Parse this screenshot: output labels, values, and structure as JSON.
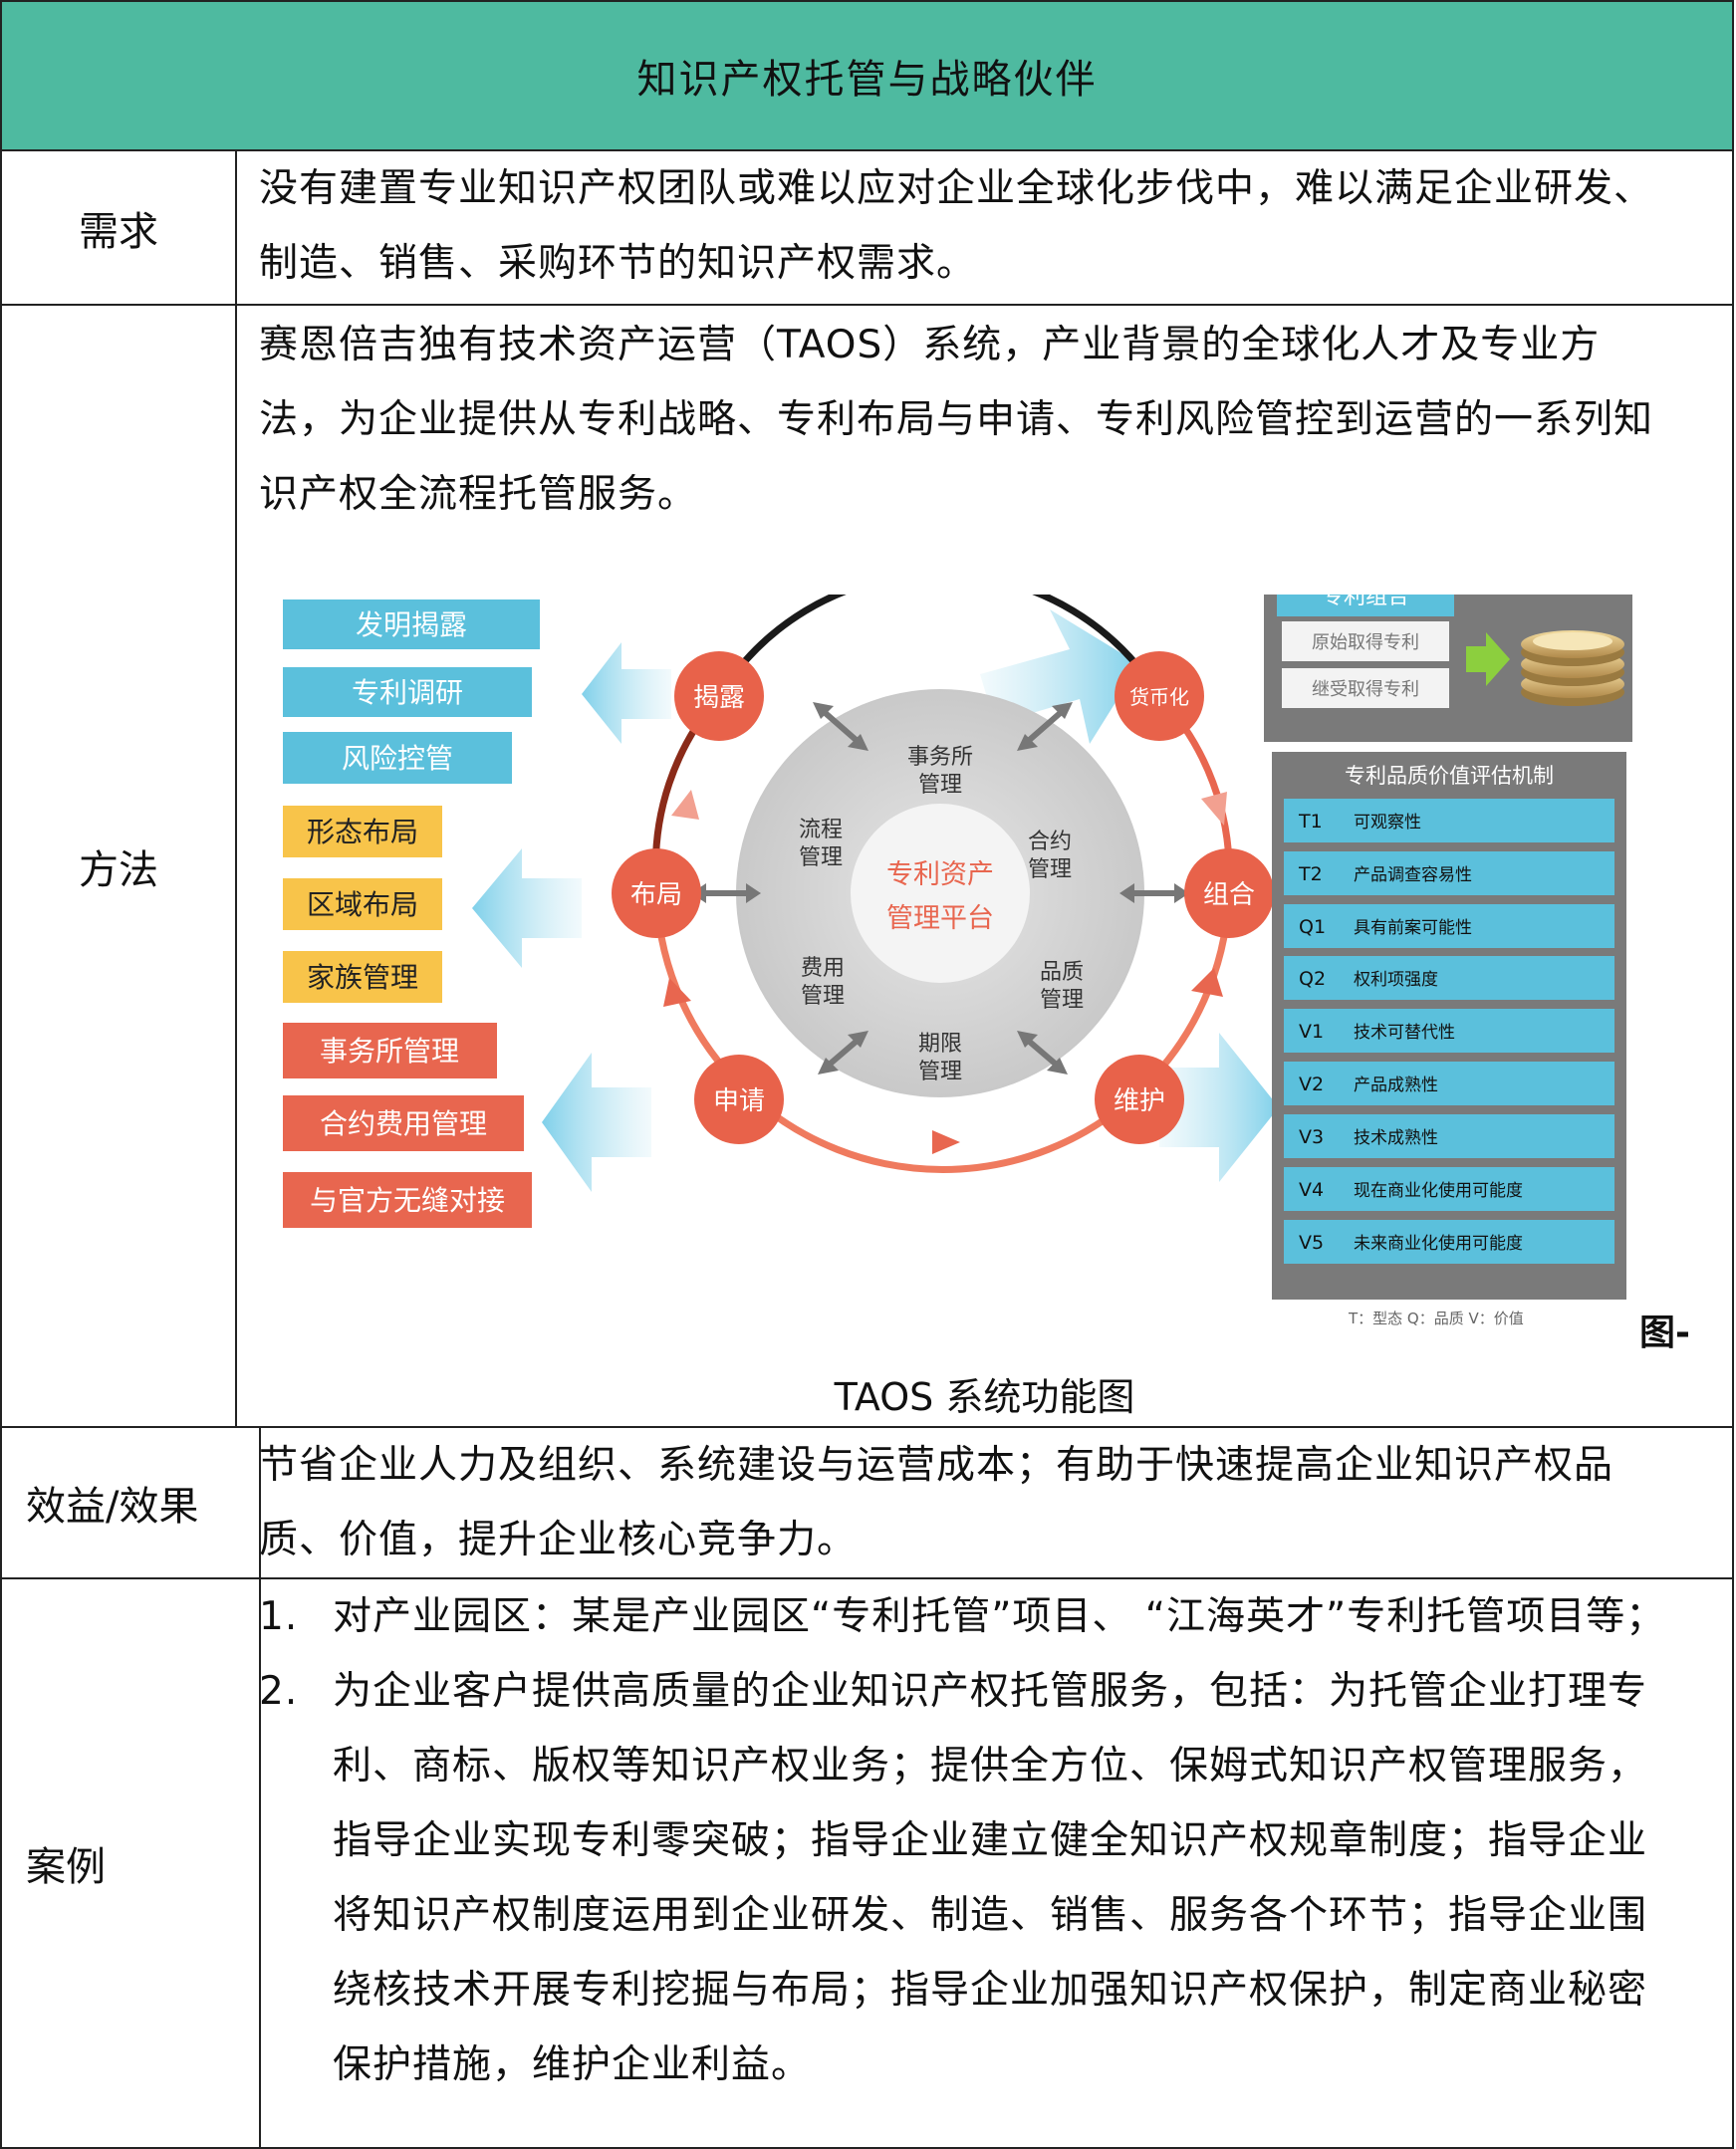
{
  "title": "知识产权托管与战略伙伴",
  "rows": {
    "need": {
      "label": "需求",
      "lines": [
        "没有建置专业知识产权团队或难以应对企业全球化步伐中，难以满足企业研发、",
        "制造、销售、采购环节的知识产权需求。"
      ]
    },
    "method": {
      "label": "方法",
      "lines": [
        "赛恩倍吉独有技术资产运营（TAOS）系统，产业背景的全球化人才及专业方",
        "法，为企业提供从专利战略、专利布局与申请、专利风险管控到运营的一系列知",
        "识产权全流程托管服务。"
      ],
      "figure_mark": "图-",
      "caption": "TAOS 系统功能图"
    },
    "benefit": {
      "label": "效益/效果",
      "lines": [
        "节省企业人力及组织、系统建设与运营成本；有助于快速提高企业知识产权品",
        "质、价值，提升企业核心竞争力。"
      ]
    },
    "case": {
      "label": "案例",
      "items": [
        {
          "num": "1.",
          "lines": [
            "对产业园区：某是产业园区“专利托管”项目、 “江海英才”专利托管项目等；"
          ]
        },
        {
          "num": "2.",
          "lines": [
            "为企业客户提供高质量的企业知识产权托管服务，包括：为托管企业打理专",
            "利、商标、版权等知识产权业务；提供全方位、保姆式知识产权管理服务，",
            "指导企业实现专利零突破；指导企业建立健全知识产权规章制度；指导企业",
            "将知识产权制度运用到企业研发、制造、销售、服务各个环节；指导企业围",
            "绕核技术开展专利挖掘与布局；指导企业加强知识产权保护，制定商业秘密",
            "保护措施，维护企业利益。"
          ]
        }
      ]
    }
  },
  "diagram": {
    "left_blue": [
      "发明揭露",
      "专利调研",
      "风险控管"
    ],
    "left_yellow": [
      "形态布局",
      "区域布局",
      "家族管理"
    ],
    "left_red": [
      "事务所管理",
      "合约费用管理",
      "与官方无缝对接"
    ],
    "ring_nodes": {
      "disclose": "揭露",
      "monetize": "货币化",
      "layout": "布局",
      "combine": "组合",
      "apply": "申请",
      "maintain": "维护"
    },
    "inner": {
      "firm": "事务所\n管理",
      "process": "流程\n管理",
      "contract": "合约\n管理",
      "fee": "费用\n管理",
      "quality": "品质\n管理",
      "term": "期限\n管理"
    },
    "center": [
      "专利资产",
      "管理平台"
    ],
    "portfolio": {
      "title": "专利组合",
      "items": [
        "原始取得专利",
        "继受取得专利"
      ]
    },
    "evaluation": {
      "title": "专利品质价值评估机制",
      "rows": [
        {
          "code": "T1",
          "text": "可观察性"
        },
        {
          "code": "T2",
          "text": "产品调查容易性"
        },
        {
          "code": "Q1",
          "text": "具有前案可能性"
        },
        {
          "code": "Q2",
          "text": "权利项强度"
        },
        {
          "code": "V1",
          "text": "技术可替代性"
        },
        {
          "code": "V2",
          "text": "产品成熟性"
        },
        {
          "code": "V3",
          "text": "技术成熟性"
        },
        {
          "code": "V4",
          "text": "现在商业化使用可能度"
        },
        {
          "code": "V5",
          "text": "未来商业化使用可能度"
        }
      ],
      "legend": "T：型态  Q：品质  V：价值"
    },
    "colors": {
      "blue": "#5bc0dc",
      "yellow": "#f8c44a",
      "red": "#e8664f",
      "node": "#e8624a",
      "grey_panel": "#7a7a7a"
    }
  }
}
